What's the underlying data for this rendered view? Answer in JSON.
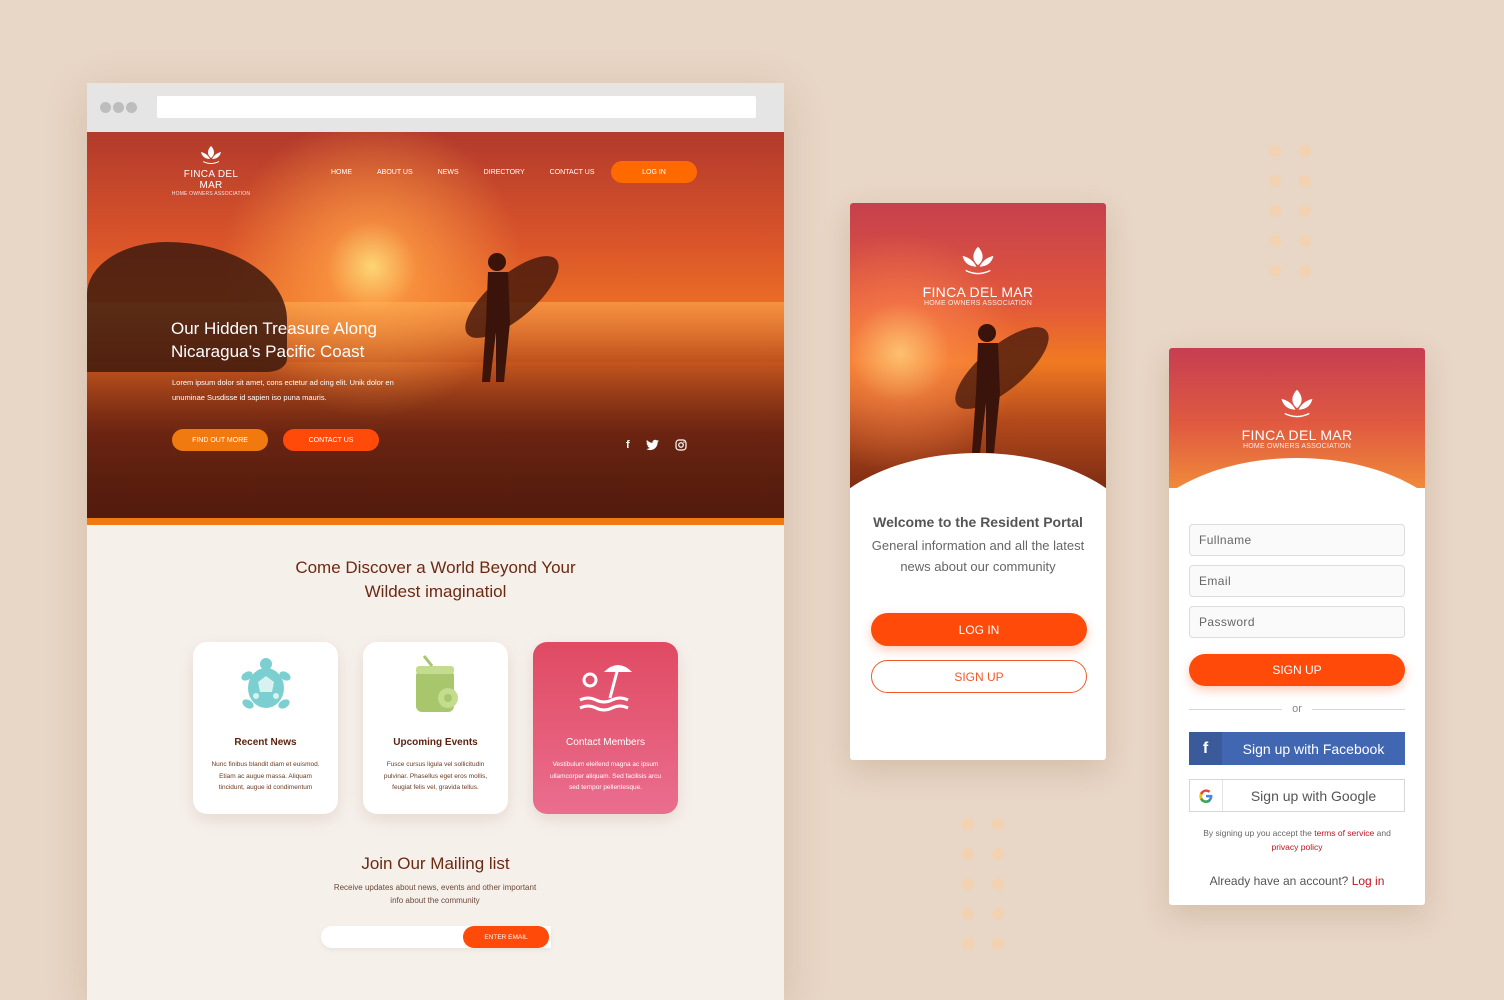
{
  "brand": {
    "name": "FINCA DEL MAR",
    "tagline": "HOME OWNERS ASSOCIATION",
    "accent_color": "#ff4a0a"
  },
  "website": {
    "nav": {
      "items": [
        "HOME",
        "ABOUT US",
        "NEWS",
        "DIRECTORY",
        "CONTACT US"
      ],
      "login_label": "LOG IN"
    },
    "hero": {
      "title_line1": "Our Hidden Treasure Along",
      "title_line2": "Nicaragua’s Pacific Coast",
      "text": "Lorem ipsum dolor sit amet, cons ectetur ad cing elit.  Unik dolor en unuminae Susdisse id sapien iso puna mauris.",
      "btn_more": "FIND OUT MORE",
      "btn_contact": "CONTACT US",
      "socials": [
        "facebook-icon",
        "twitter-icon",
        "instagram-icon"
      ]
    },
    "discover": {
      "line1": "Come Discover a World Beyond Your",
      "line2": "Wildest imaginatiol"
    },
    "cards": [
      {
        "title": "Recent News",
        "text": "Nunc finibus blandit diam et euismod. Etiam ac augue massa. Aliquam tincidunt, augue id condimentum",
        "icon": "turtle-icon"
      },
      {
        "title": "Upcoming Events",
        "text": "Fusce cursus ligula vel sollicitudin pulvinar. Phasellus eget eros mollis, feugiat felis vel, gravida tellus.",
        "icon": "coconut-drink-icon"
      },
      {
        "title": "Contact Members",
        "text": "Vestibulum eleifend magna ac ipsum ullamcorper aliquam. Sed facilisis arcu sed tempor pellentesque.",
        "icon": "beach-umbrella-icon"
      }
    ],
    "mailing": {
      "title": "Join Our Mailing list",
      "text": "Receive updates about news, events and other important info about the community",
      "button": "ENTER EMAIL"
    }
  },
  "portal": {
    "welcome": "Welcome to the Resident Portal",
    "description": "General information and all the latest news about our community",
    "login": "LOG IN",
    "signup": "SIGN UP"
  },
  "signup_form": {
    "fullname_placeholder": "Fullname",
    "email_placeholder": "Email",
    "password_placeholder": "Password",
    "submit": "SIGN UP",
    "or": "or",
    "facebook": "Sign up with Facebook",
    "google": "Sign up with Google",
    "terms_prefix": "By signing up you accept the",
    "terms_link": "terms of service",
    "terms_and": "and",
    "privacy_link": "privacy policy",
    "already": "Already have an account?",
    "login_link": "Log in"
  }
}
